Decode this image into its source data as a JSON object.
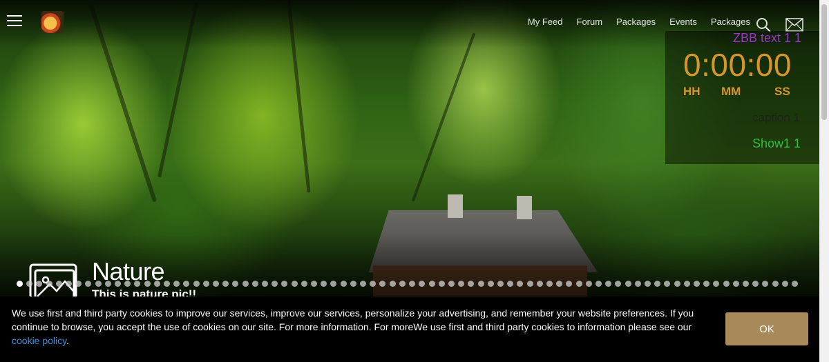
{
  "header": {
    "nav": [
      "My Feed",
      "Forum",
      "Packages",
      "Events",
      "Packages"
    ]
  },
  "icons": {
    "menu": "hamburger-icon",
    "logo": "mushroom-logo",
    "search": "search-icon",
    "mail": "mail-icon",
    "slide": "image-icon"
  },
  "countdown": {
    "title": "ZBB text 1 1",
    "time": "0:00:00",
    "units": [
      "HH",
      "MM",
      "SS"
    ],
    "faint_text": "caption 1",
    "show_text": "Show1 1",
    "colors": {
      "title": "#9b36c7",
      "time": "#d6952b",
      "show": "#2fbf3a"
    }
  },
  "slide": {
    "title": "Nature",
    "subtitle": "This is nature pic!!",
    "dot_count": 80,
    "active_dot": 1
  },
  "cookie": {
    "text": "We use first and third party cookies to improve our services, improve our services, personalize your advertising, and remember your website preferences. If you continue to browse, you accept the use of cookies on our site. For more information. For moreWe use first and third party cookies to information please see our ",
    "link": "cookie policy",
    "end": ".",
    "button": "OK",
    "button_color": "#a8895a",
    "link_color": "#3b8fdc"
  }
}
